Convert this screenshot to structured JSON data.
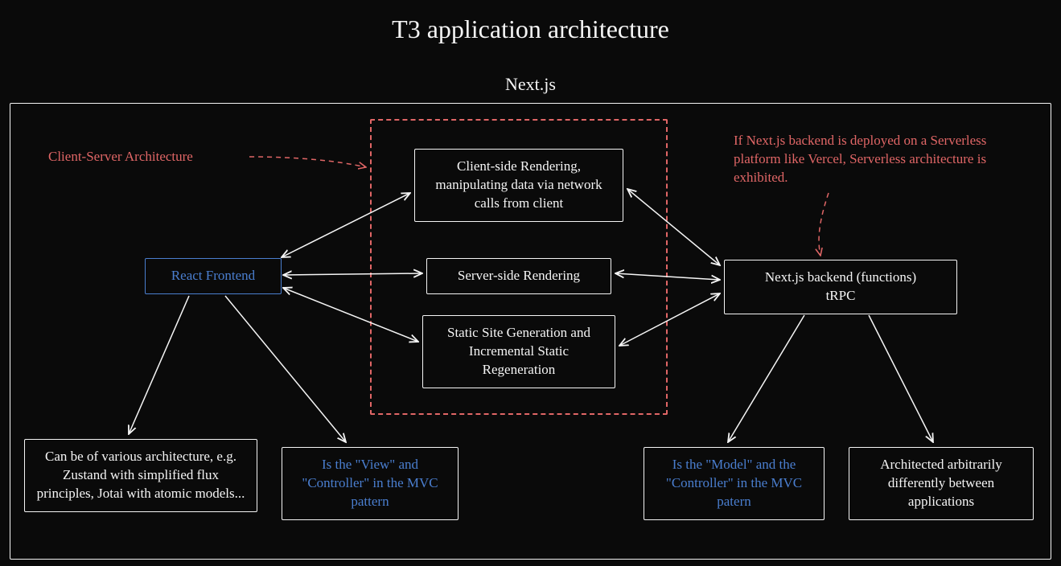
{
  "title": "T3 application architecture",
  "framework_label": "Next.js",
  "notes": {
    "client_server": "Client-Server Architecture",
    "serverless": "If Next.js backend is deployed on a Serverless platform like Vercel, Serverless architecture is exhibited."
  },
  "boxes": {
    "react_frontend": "React Frontend",
    "csr": "Client-side Rendering, manipulating data via network calls from client",
    "ssr": "Server-side Rendering",
    "ssg": "Static Site Generation and Incremental Static Regeneration",
    "backend_line1": "Next.js backend (functions)",
    "backend_line2": "tRPC",
    "frontend_arch_note": "Can be of various architecture, e.g. Zustand with simplified flux principles, Jotai with atomic models...",
    "frontend_mvc": "Is the \"View\" and \"Controller\" in the MVC pattern",
    "backend_mvc": "Is the \"Model\" and the \"Controller\" in the MVC patern",
    "backend_arch_note": "Architected arbitrarily differently between applications"
  }
}
